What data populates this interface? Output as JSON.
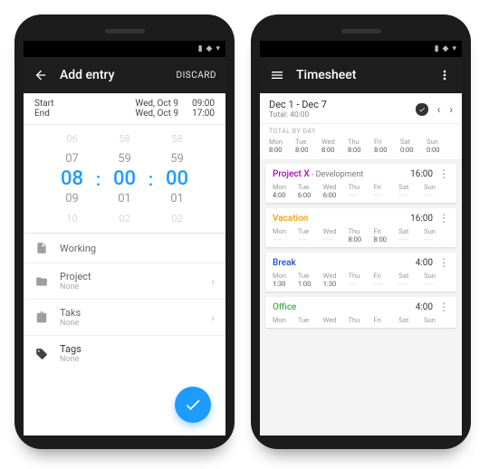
{
  "phone1": {
    "appbar": {
      "title": "Add entry",
      "discard": "DISCARD"
    },
    "range": {
      "start_label": "Start",
      "end_label": "End",
      "start_date": "Wed, Oct 9",
      "start_time": "09:00",
      "end_date": "Wed, Oct 9",
      "end_time": "17:00"
    },
    "picker": {
      "h": [
        "06",
        "07",
        "08",
        "09",
        "10"
      ],
      "m": [
        "58",
        "59",
        "00",
        "01",
        "02"
      ],
      "s": [
        "58",
        "59",
        "00",
        "01",
        "02"
      ],
      "sep": ":"
    },
    "rows": {
      "working": "Working",
      "project_label": "Project",
      "project_value": "None",
      "task_label": "Taks",
      "task_value": "None",
      "tags_label": "Tags",
      "tags_value": "None"
    }
  },
  "phone2": {
    "appbar": {
      "title": "Timesheet"
    },
    "header": {
      "range": "Dec 1 - Dec 7",
      "total": "Total: 40:00"
    },
    "tbd_label": "TOTAL BY DAY",
    "days": [
      "Mon",
      "Tue",
      "Wed",
      "Thu",
      "Fri",
      "Sat",
      "Sun"
    ],
    "day_totals": [
      "8:00",
      "8:00",
      "8:00",
      "8:00",
      "8:00",
      "0:00",
      "0:00"
    ],
    "cards": [
      {
        "name": "Project X",
        "ext": " - Development",
        "color": "#b400c8",
        "total": "16:00",
        "vals": [
          "4:00",
          "6:00",
          "6:00",
          "--:--",
          "--:--",
          "--:--",
          "--:--"
        ]
      },
      {
        "name": "Vacation",
        "ext": "",
        "color": "#f0a000",
        "total": "16:00",
        "vals": [
          "--:--",
          "--:--",
          "--:--",
          "8:00",
          "8:00",
          "--:--",
          "--:--"
        ]
      },
      {
        "name": "Break",
        "ext": "",
        "color": "#2050d0",
        "total": "4:00",
        "vals": [
          "1:30",
          "1:00",
          "1:30",
          "--:--",
          "--:--",
          "--:--",
          "--:--"
        ]
      },
      {
        "name": "Office",
        "ext": "",
        "color": "#4caf50",
        "total": "4:00",
        "vals": [
          "",
          "",
          "",
          "",
          "",
          "",
          ""
        ]
      }
    ]
  }
}
